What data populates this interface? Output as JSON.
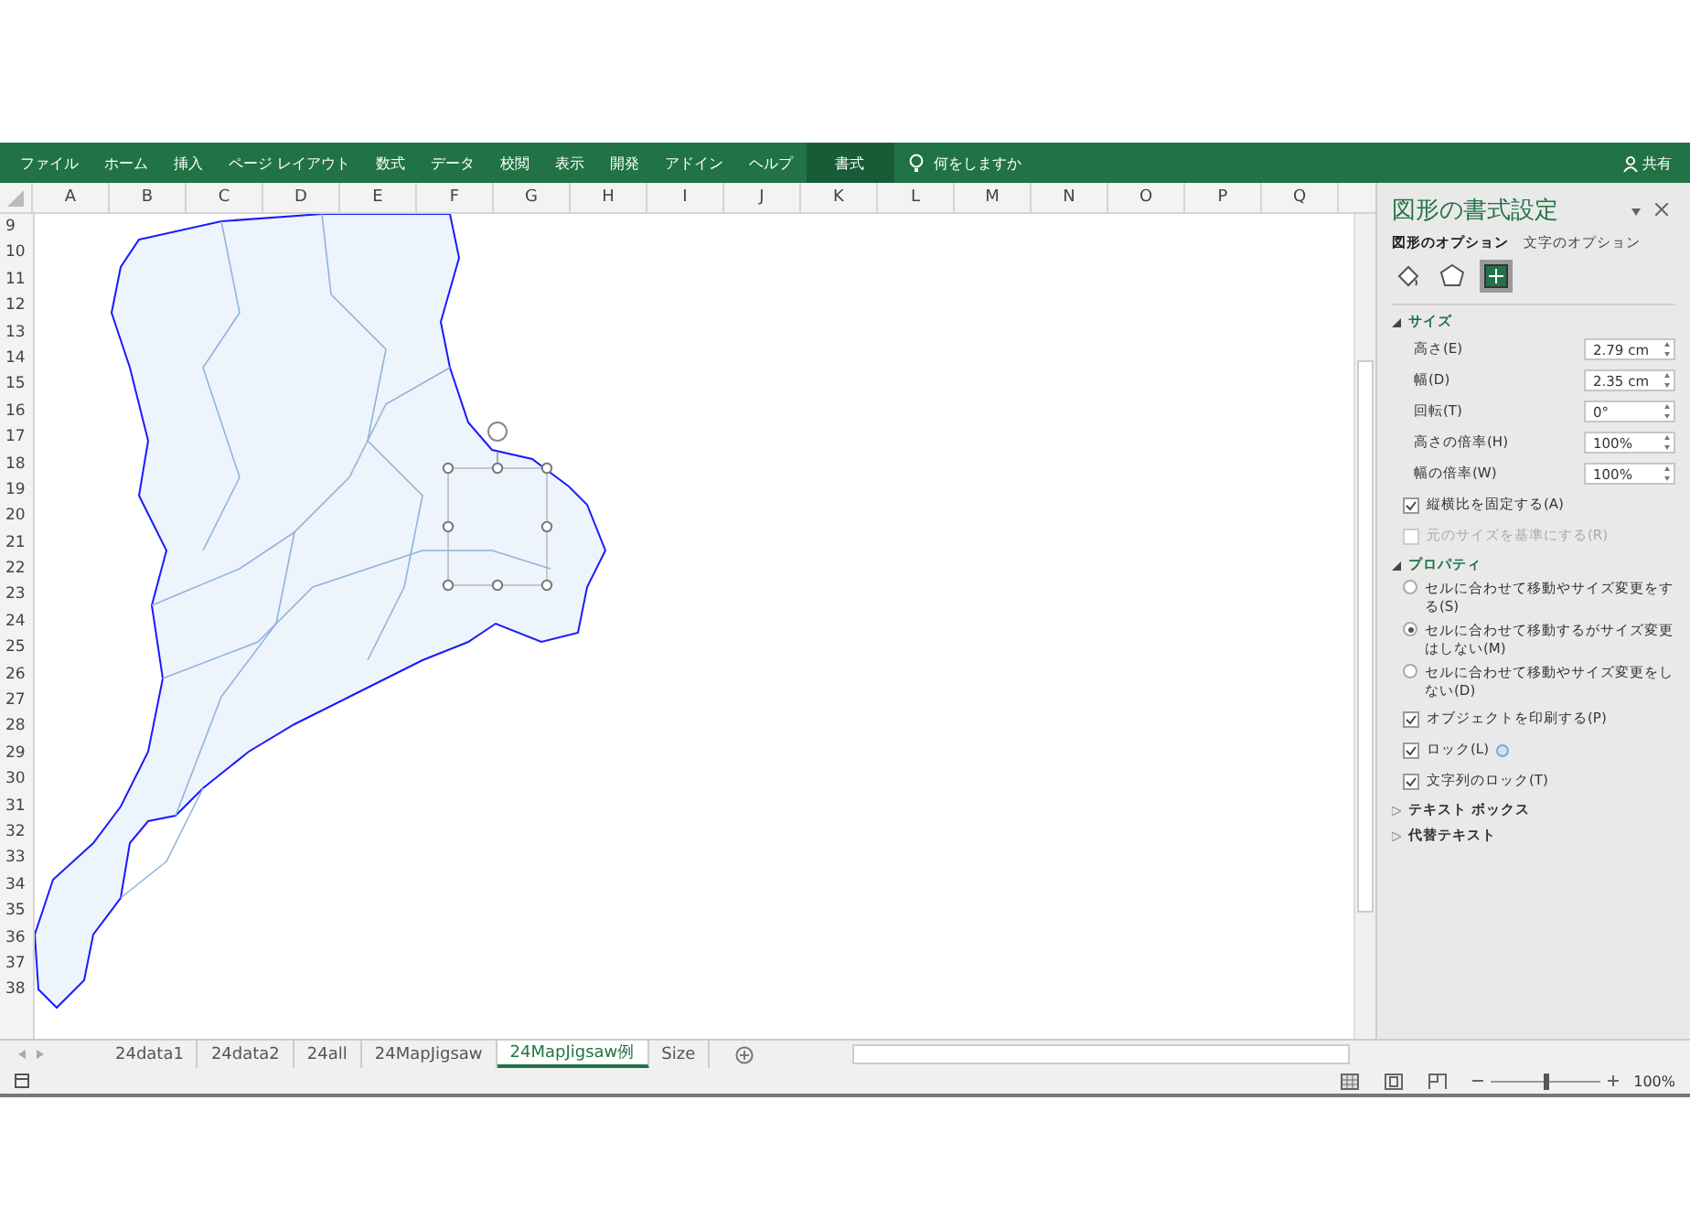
{
  "ribbon": {
    "tabs": [
      {
        "label": "ファイル",
        "selected": false
      },
      {
        "label": "ホーム",
        "selected": false
      },
      {
        "label": "挿入",
        "selected": false
      },
      {
        "label": "ページ レイアウト",
        "selected": false
      },
      {
        "label": "数式",
        "selected": false
      },
      {
        "label": "データ",
        "selected": false
      },
      {
        "label": "校閲",
        "selected": false
      },
      {
        "label": "表示",
        "selected": false
      },
      {
        "label": "開発",
        "selected": false
      },
      {
        "label": "アドイン",
        "selected": false
      },
      {
        "label": "ヘルプ",
        "selected": false
      },
      {
        "label": "書式",
        "selected": true
      }
    ],
    "tell_me": "何をしますか",
    "share": "共有"
  },
  "sheet": {
    "columns": [
      "A",
      "B",
      "C",
      "D",
      "E",
      "F",
      "G",
      "H",
      "I",
      "J",
      "K",
      "L",
      "M",
      "N",
      "O",
      "P",
      "Q"
    ],
    "rows": [
      "9",
      "10",
      "11",
      "12",
      "13",
      "14",
      "15",
      "16",
      "17",
      "18",
      "19",
      "20",
      "21",
      "22",
      "23",
      "24",
      "25",
      "26",
      "27",
      "28",
      "29",
      "30",
      "31",
      "32",
      "33",
      "34",
      "35",
      "36",
      "37",
      "38"
    ]
  },
  "pane": {
    "title": "図形の書式設定",
    "tabs": [
      {
        "label": "図形のオプション",
        "selected": true
      },
      {
        "label": "文字のオプション",
        "selected": false
      }
    ],
    "icon_tabs": [
      {
        "kind": "fill",
        "selected": false
      },
      {
        "kind": "shape",
        "selected": false
      },
      {
        "kind": "size",
        "selected": true
      }
    ],
    "sections": [
      {
        "title": "サイズ",
        "expanded": true,
        "items": [
          {
            "kind": "spin",
            "label": "高さ(E)",
            "value": "2.79 cm"
          },
          {
            "kind": "spin",
            "label": "幅(D)",
            "value": "2.35 cm"
          },
          {
            "kind": "spin",
            "label": "回転(T)",
            "value": "0°"
          },
          {
            "kind": "spin",
            "label": "高さの倍率(H)",
            "value": "100%"
          },
          {
            "kind": "spin",
            "label": "幅の倍率(W)",
            "value": "100%"
          },
          {
            "kind": "check",
            "label": "縦横比を固定する(A)",
            "checked": true,
            "disabled": false
          },
          {
            "kind": "check",
            "label": "元のサイズを基準にする(R)",
            "checked": false,
            "disabled": true
          }
        ]
      },
      {
        "title": "プロパティ",
        "expanded": true,
        "items": [
          {
            "kind": "radio",
            "label": "セルに合わせて移動やサイズ変更をする(S)",
            "selected": false
          },
          {
            "kind": "radio",
            "label": "セルに合わせて移動するがサイズ変更はしない(M)",
            "selected": true
          },
          {
            "kind": "radio",
            "label": "セルに合わせて移動やサイズ変更をしない(D)",
            "selected": false
          },
          {
            "kind": "check",
            "label": "オブジェクトを印刷する(P)",
            "checked": true,
            "disabled": false
          },
          {
            "kind": "check",
            "label": "ロック(L)",
            "checked": true,
            "disabled": false,
            "info": true
          },
          {
            "kind": "check",
            "label": "文字列のロック(T)",
            "checked": true,
            "disabled": false
          }
        ]
      },
      {
        "title": "テキスト ボックス",
        "expanded": false
      },
      {
        "title": "代替テキスト",
        "expanded": false
      }
    ]
  },
  "sheet_tabs": [
    {
      "label": "24data1",
      "selected": false
    },
    {
      "label": "24data2",
      "selected": false
    },
    {
      "label": "24all",
      "selected": false
    },
    {
      "label": "24MapJigsaw",
      "selected": false
    },
    {
      "label": "24MapJigsaw例",
      "selected": true
    },
    {
      "label": "Size",
      "selected": false
    }
  ],
  "status_bar": {
    "zoom": {
      "level": 0.5,
      "reading": "100%"
    }
  }
}
